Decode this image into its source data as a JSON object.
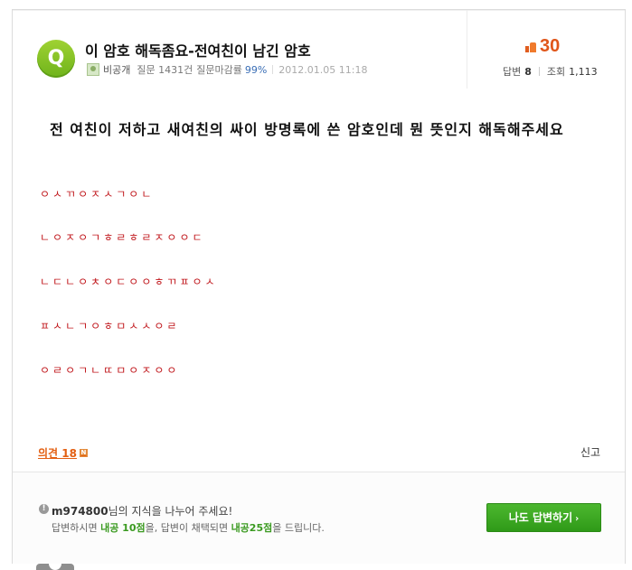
{
  "question": {
    "badge": "Q",
    "title": "이 암호 해독좀요-전여친이 남긴 암호",
    "author": "비공개",
    "question_count": "질문 1431건",
    "closing_rate_label": "질문마감률",
    "closing_rate": "99%",
    "date": "2012.01.05 11:18"
  },
  "stats": {
    "points": "30",
    "answers_label": "답변",
    "answers": "8",
    "views_label": "조회",
    "views": "1,113"
  },
  "body": {
    "headline": "전 여친이 저하고 새여친의 싸이 방명록에 쓴 암호인데 뭔 뜻인지 해독해주세요",
    "code_lines": [
      "ㅇㅅㄲㅇㅈㅅㄱㅇㄴ",
      "ㄴㅇㅈㅇㄱㅎㄹㅎㄹㅈㅇㅇㄷ",
      "ㄴㄷㄴㅇㅊㅇㄷㅇㅇㅎㄲㅍㅇㅅ",
      "ㅍㅅㄴㄱㅇㅎㅁㅅㅅㅇㄹ",
      "ㅇㄹㅇㄱㄴㄸㅁㅇㅈㅇㅇ"
    ]
  },
  "footer": {
    "comments_label": "의견 18",
    "new_badge": "N",
    "report_label": "신고"
  },
  "invite": {
    "info_icon": "!",
    "username": "m974800",
    "message": "님의 지식을 나누어 주세요!",
    "reward_prefix": "답변하시면 ",
    "reward_a": "내공 10점",
    "reward_mid": "을, 답변이 채택되면 ",
    "reward_b": "내공25점",
    "reward_suffix": "을 드립니다.",
    "button_label": "나도 답변하기",
    "button_arrow": "›"
  }
}
